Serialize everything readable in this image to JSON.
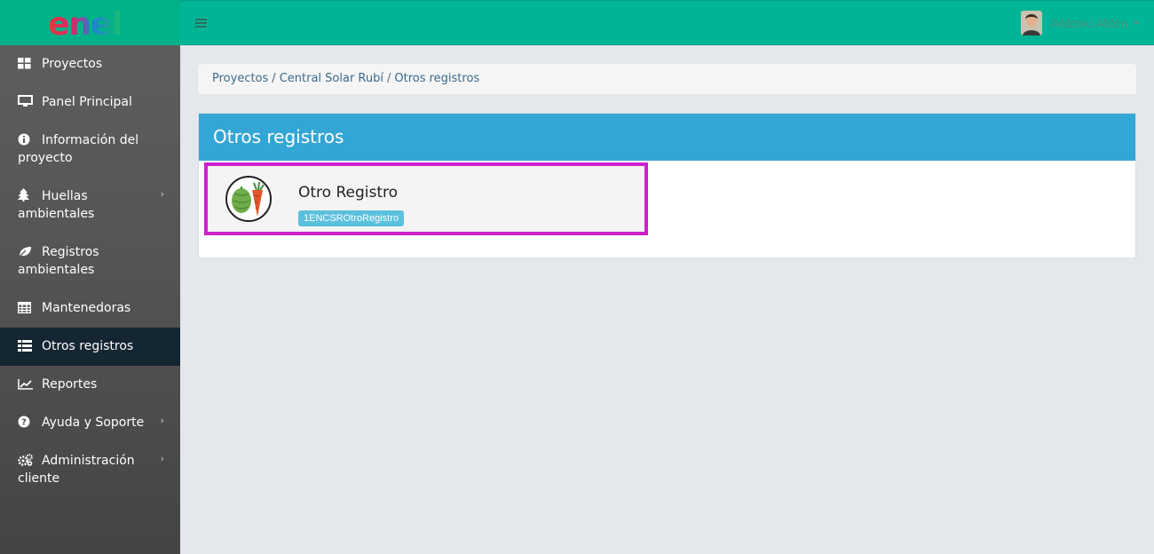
{
  "brand": {
    "logo_text": "enel",
    "accent": "#00b596"
  },
  "sidebar": {
    "items": [
      {
        "label": "Proyectos",
        "icon": "grid-icon"
      },
      {
        "label": "Panel Principal",
        "icon": "monitor-icon"
      },
      {
        "label": "Información del proyecto",
        "icon": "info-icon"
      },
      {
        "label": "Huellas ambientales",
        "icon": "tree-icon"
      },
      {
        "label": "Registros ambientales",
        "icon": "leaf-icon"
      },
      {
        "label": "Mantenedoras",
        "icon": "table-icon"
      },
      {
        "label": "Otros registros",
        "icon": "list-icon"
      },
      {
        "label": "Reportes",
        "icon": "chart-line-icon"
      },
      {
        "label": "Ayuda y Soporte",
        "icon": "question-icon"
      },
      {
        "label": "Administración cliente",
        "icon": "gears-icon"
      }
    ],
    "active": "Otros registros"
  },
  "header": {
    "user_name": "Antonio Aldón"
  },
  "breadcrumb": {
    "items": [
      "Proyectos",
      "Central Solar Rubí",
      "Otros registros"
    ]
  },
  "panel": {
    "title": "Otros registros",
    "card": {
      "title": "Otro Registro",
      "badge": "1ENCSROtroRegistro",
      "icon": "artichoke-carrot-icon"
    }
  }
}
